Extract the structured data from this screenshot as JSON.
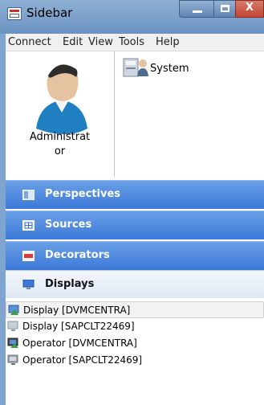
{
  "window": {
    "title": "Sidebar"
  },
  "menu": [
    "Connect",
    "Edit",
    "View",
    "Tools",
    "Help"
  ],
  "user": {
    "name_line1": "Administrat",
    "name_line2": "or"
  },
  "system": {
    "label": "System"
  },
  "sections": [
    {
      "label": "Perspectives",
      "icon": "perspectives-icon"
    },
    {
      "label": "Sources",
      "icon": "sources-icon"
    },
    {
      "label": "Decorators",
      "icon": "decorators-icon"
    },
    {
      "label": "Displays",
      "icon": "displays-icon"
    }
  ],
  "displays": [
    {
      "label": "Display [DVMCENTRA]",
      "icon": "display-connected-icon"
    },
    {
      "label": "Display [SAPCLT22469]",
      "icon": "display-icon"
    },
    {
      "label": "Operator [DVMCENTRA]",
      "icon": "operator-connected-icon"
    },
    {
      "label": "Operator [SAPCLT22469]",
      "icon": "operator-icon"
    }
  ]
}
